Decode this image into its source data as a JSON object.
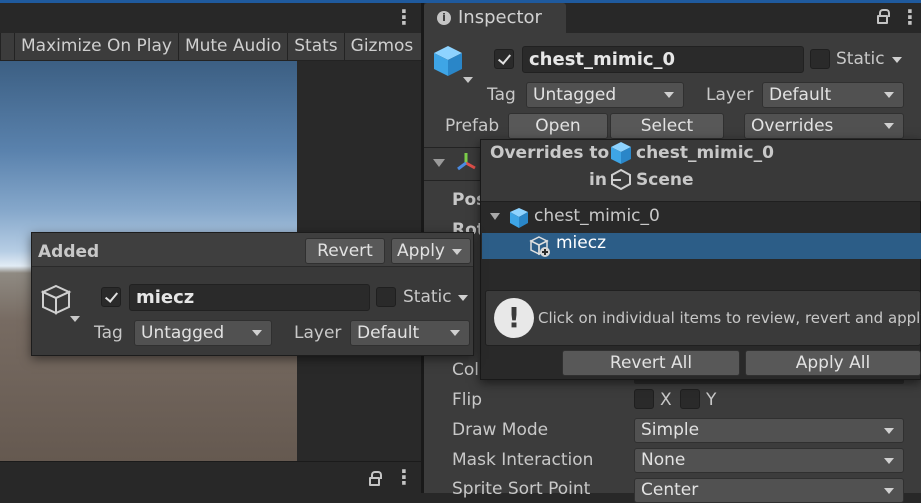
{
  "colors": {
    "accent": "#1f5a9e",
    "selection": "#2c5d87",
    "cube_blue": "#3ea5e6"
  },
  "game_view": {
    "toolbar": [
      "Maximize On Play",
      "Mute Audio",
      "Stats",
      "Gizmos"
    ]
  },
  "inspector": {
    "tab_title": "Inspector",
    "object_name": "chest_mimic_0",
    "static_label": "Static",
    "tag_label": "Tag",
    "tag_value": "Untagged",
    "layer_label": "Layer",
    "layer_value": "Default",
    "prefab_label": "Prefab",
    "open_label": "Open",
    "select_label": "Select",
    "overrides_label": "Overrides",
    "fields": {
      "pos": "Pos",
      "rot": "Rot",
      "col": "Col",
      "flip_label": "Flip",
      "flip_x": "X",
      "flip_y": "Y",
      "draw_mode_label": "Draw Mode",
      "draw_mode_value": "Simple",
      "mask_label": "Mask Interaction",
      "mask_value": "None",
      "sort_label": "Sprite Sort Point",
      "sort_value": "Center"
    }
  },
  "overrides_popup": {
    "title_prefix": "Overrides to",
    "title_object": "chest_mimic_0",
    "in_label": "in",
    "scene_label": "Scene",
    "tree_root": "chest_mimic_0",
    "tree_child": "miecz",
    "message": "Click on individual items to review, revert and apply.",
    "revert_all": "Revert All",
    "apply_all": "Apply All"
  },
  "added_popup": {
    "title": "Added",
    "revert": "Revert",
    "apply": "Apply",
    "object_name": "miecz",
    "static_label": "Static",
    "tag_label": "Tag",
    "tag_value": "Untagged",
    "layer_label": "Layer",
    "layer_value": "Default"
  }
}
